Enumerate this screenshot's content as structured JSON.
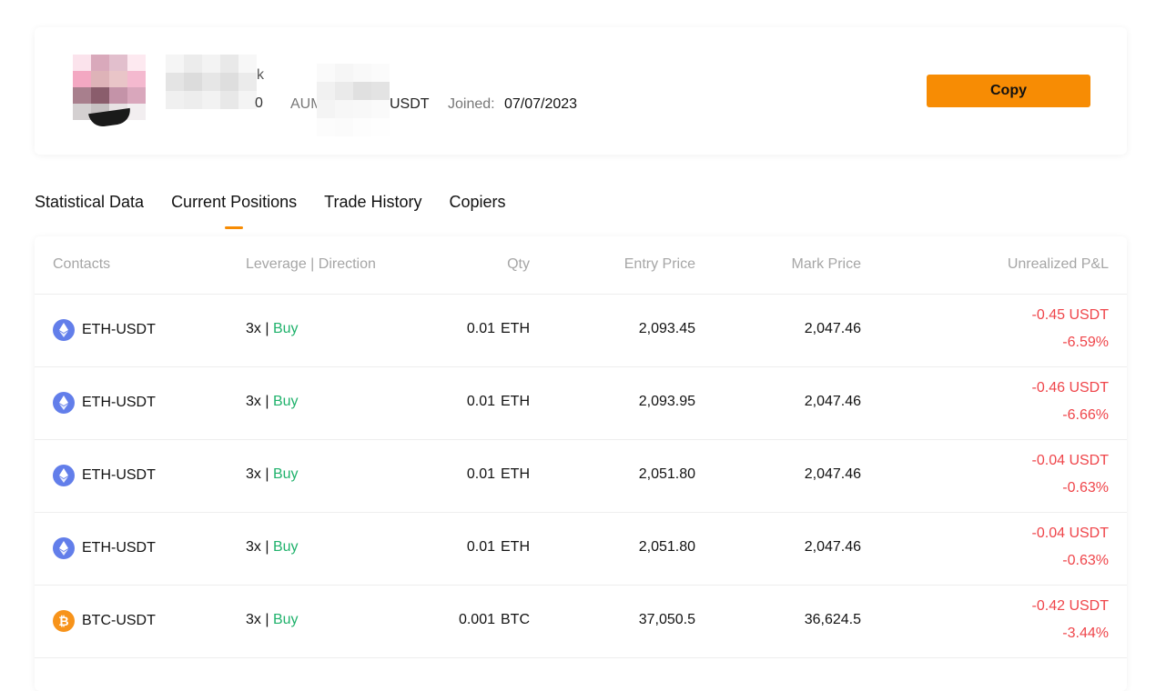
{
  "profile": {
    "name_suffix_1": "k",
    "name_suffix_2": "0",
    "aum_label": "AUM",
    "aum_unit": "USDT",
    "joined_label": "Joined:",
    "joined_value": "07/07/2023",
    "copy_label": "Copy"
  },
  "tabs": [
    {
      "label": "Statistical Data"
    },
    {
      "label": "Current Positions"
    },
    {
      "label": "Trade History"
    },
    {
      "label": "Copiers"
    }
  ],
  "table": {
    "headers": {
      "contract": "Contacts",
      "leverage": "Leverage | Direction",
      "qty": "Qty",
      "entry": "Entry Price",
      "mark": "Mark Price",
      "pnl": "Unrealized P&L"
    },
    "rows": [
      {
        "icon": "eth-icon",
        "pair": "ETH-USDT",
        "leverage": "3x",
        "sep": "|",
        "direction": "Buy",
        "qty": "0.01",
        "qty_unit": "ETH",
        "entry": "2,093.45",
        "mark": "2,047.46",
        "pnl_value": "-0.45 USDT",
        "pnl_percent": "-6.59%"
      },
      {
        "icon": "eth-icon",
        "pair": "ETH-USDT",
        "leverage": "3x",
        "sep": "|",
        "direction": "Buy",
        "qty": "0.01",
        "qty_unit": "ETH",
        "entry": "2,093.95",
        "mark": "2,047.46",
        "pnl_value": "-0.46 USDT",
        "pnl_percent": "-6.66%"
      },
      {
        "icon": "eth-icon",
        "pair": "ETH-USDT",
        "leverage": "3x",
        "sep": "|",
        "direction": "Buy",
        "qty": "0.01",
        "qty_unit": "ETH",
        "entry": "2,051.80",
        "mark": "2,047.46",
        "pnl_value": "-0.04 USDT",
        "pnl_percent": "-0.63%"
      },
      {
        "icon": "eth-icon",
        "pair": "ETH-USDT",
        "leverage": "3x",
        "sep": "|",
        "direction": "Buy",
        "qty": "0.01",
        "qty_unit": "ETH",
        "entry": "2,051.80",
        "mark": "2,047.46",
        "pnl_value": "-0.04 USDT",
        "pnl_percent": "-0.63%"
      },
      {
        "icon": "btc-icon",
        "pair": "BTC-USDT",
        "leverage": "3x",
        "sep": "|",
        "direction": "Buy",
        "qty": "0.001",
        "qty_unit": "BTC",
        "entry": "37,050.5",
        "mark": "36,624.5",
        "pnl_value": "-0.42 USDT",
        "pnl_percent": "-3.44%"
      }
    ]
  },
  "colors": {
    "accent": "#f78c04",
    "buy": "#20b26c",
    "loss": "#ef454a",
    "eth": "#627eea",
    "btc": "#f7931a"
  }
}
